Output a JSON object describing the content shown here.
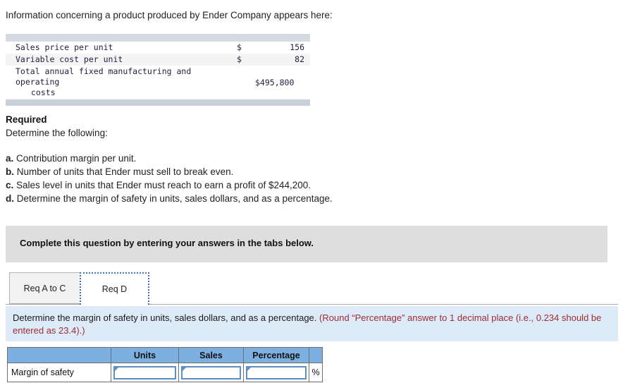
{
  "intro": "Information concerning a product produced by Ender Company appears here:",
  "facts_table": {
    "rows": [
      {
        "label": "Sales price per unit",
        "currency": "$",
        "value": "156"
      },
      {
        "label": "Variable cost per unit",
        "currency": "$",
        "value": "82"
      },
      {
        "label_line1": "Total annual fixed manufacturing and operating",
        "label_line2": "costs",
        "value": "$495,800"
      }
    ]
  },
  "required": {
    "heading": "Required",
    "subheading": "Determine the following:",
    "items": [
      {
        "marker": "a.",
        "text": "Contribution margin per unit."
      },
      {
        "marker": "b.",
        "text": "Number of units that Ender must sell to break even."
      },
      {
        "marker": "c.",
        "text": "Sales level in units that Ender must reach to earn a profit of $244,200."
      },
      {
        "marker": "d.",
        "text": "Determine the margin of safety in units, sales dollars, and as a percentage."
      }
    ]
  },
  "complete_banner": {
    "text": "Complete this question by entering your answers in the tabs below."
  },
  "tabs": [
    {
      "label": "Req A to C",
      "active": false
    },
    {
      "label": "Req D",
      "active": true
    }
  ],
  "instruction_panel": {
    "main": "Determine the margin of safety in units, sales dollars, and as a percentage.",
    "hint": "(Round “Percentage” answer to 1 decimal place (i.e., 0.234 should be entered as 23.4).)"
  },
  "answer_table": {
    "headers": [
      "",
      "Units",
      "Sales",
      "Percentage",
      ""
    ],
    "row_label": "Margin of safety",
    "percent_symbol": "%",
    "values": {
      "units": "",
      "sales": "",
      "percentage": ""
    }
  },
  "colors": {
    "banner_gray": "#dedede",
    "panel_blue": "#ddeaf7",
    "hint_red": "#9d2b33",
    "table_header_blue": "#7db0e0",
    "field_border_blue": "#5b8fc9",
    "facts_band": "#d5dae3"
  }
}
